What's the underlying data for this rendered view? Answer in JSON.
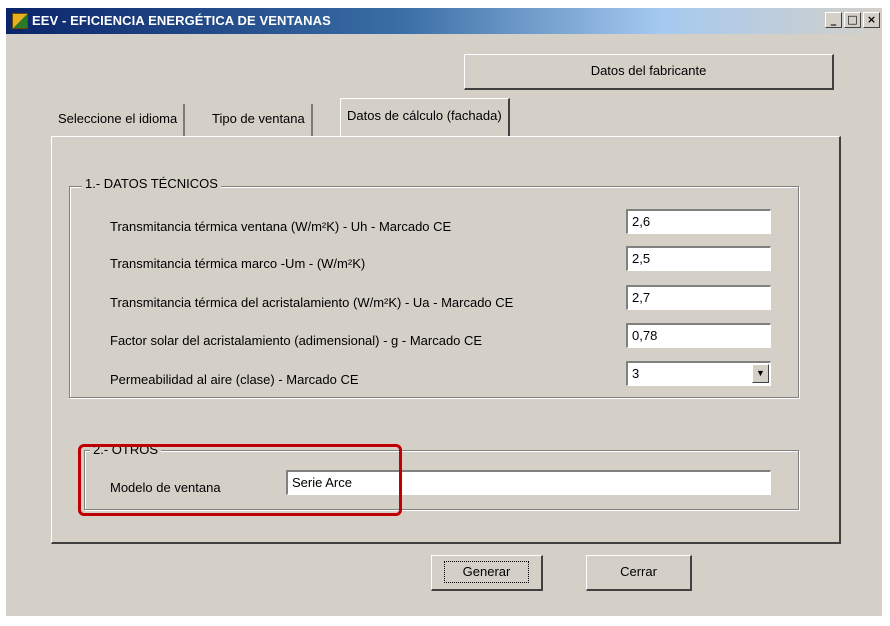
{
  "window": {
    "title": "EEV - EFICIENCIA ENERGÉTICA DE VENTANAS",
    "controls": {
      "minimize": "_",
      "maximize": "□",
      "close": "×"
    }
  },
  "header": {
    "manufacturer_button": "Datos del fabricante"
  },
  "tabs": [
    {
      "label": "Seleccione el idioma"
    },
    {
      "label": "Tipo de ventana"
    },
    {
      "label": "Datos de cálculo (fachada)"
    }
  ],
  "technical": {
    "title": "1.- DATOS TÉCNICOS",
    "rows": [
      {
        "label": "Transmitancia térmica ventana (W/m²K) - Uh - Marcado CE",
        "value": "2,6"
      },
      {
        "label": "Transmitancia térmica marco -Um - (W/m²K)",
        "value": "2,5"
      },
      {
        "label": "Transmitancia térmica del acristalamiento (W/m²K) - Ua - Marcado CE",
        "value": "2,7"
      },
      {
        "label": "Factor solar del acristalamiento (adimensional) - g - Marcado CE",
        "value": "0,78"
      },
      {
        "label": "Permeabilidad al aire (clase) - Marcado CE",
        "value": "3"
      }
    ]
  },
  "others": {
    "title": "2.- OTROS",
    "model_label": "Modelo de ventana",
    "model_value": "Serie Arce"
  },
  "footer": {
    "generate_button": "Generar",
    "close_button": "Cerrar"
  },
  "colors": {
    "highlight": "#c00000",
    "title_bar": "#0a246a",
    "face": "#d4d0c8"
  }
}
